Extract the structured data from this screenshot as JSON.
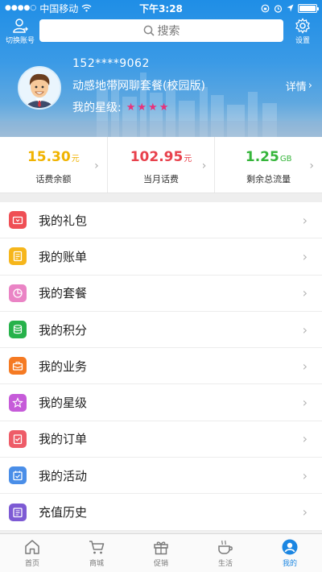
{
  "statusbar": {
    "carrier": "中国移动",
    "time": "下午3:28"
  },
  "topnav": {
    "switch_account_label": "切换账号",
    "search_placeholder": "搜索",
    "settings_label": "设置"
  },
  "profile": {
    "phone": "152****9062",
    "plan": "动感地带网聊套餐(校园版)",
    "details_label": "详情",
    "star_label": "我的星级:",
    "star_count": 4
  },
  "stats": [
    {
      "value": "15.30",
      "unit": "元",
      "label": "话费余额",
      "color": "#f0b300"
    },
    {
      "value": "102.95",
      "unit": "元",
      "label": "当月话费",
      "color": "#e8414c"
    },
    {
      "value": "1.25",
      "unit": "GB",
      "label": "剩余总流量",
      "color": "#35b53a"
    }
  ],
  "menu": [
    {
      "label": "我的礼包",
      "icon": "gift-pack-icon",
      "color": "#ef4f55"
    },
    {
      "label": "我的账单",
      "icon": "bill-icon",
      "color": "#f6b61b"
    },
    {
      "label": "我的套餐",
      "icon": "plan-icon",
      "color": "#ea84c5"
    },
    {
      "label": "我的积分",
      "icon": "points-icon",
      "color": "#27b24b"
    },
    {
      "label": "我的业务",
      "icon": "business-icon",
      "color": "#f57a23"
    },
    {
      "label": "我的星级",
      "icon": "star-level-icon",
      "color": "#c65bd9"
    },
    {
      "label": "我的订单",
      "icon": "order-icon",
      "color": "#ee5c68"
    },
    {
      "label": "我的活动",
      "icon": "activity-icon",
      "color": "#4a8ee8"
    },
    {
      "label": "充值历史",
      "icon": "recharge-history-icon",
      "color": "#7d5ad4"
    }
  ],
  "tabbar": [
    {
      "label": "首页",
      "icon": "home-icon",
      "active": false
    },
    {
      "label": "商城",
      "icon": "cart-icon",
      "active": false
    },
    {
      "label": "促销",
      "icon": "gift-icon",
      "active": false
    },
    {
      "label": "生活",
      "icon": "coffee-icon",
      "active": false
    },
    {
      "label": "我的",
      "icon": "user-icon",
      "active": true
    }
  ],
  "colors": {
    "header_blue": "#1f8ee6",
    "accent": "#1b86e2",
    "star": "#e8317a"
  }
}
